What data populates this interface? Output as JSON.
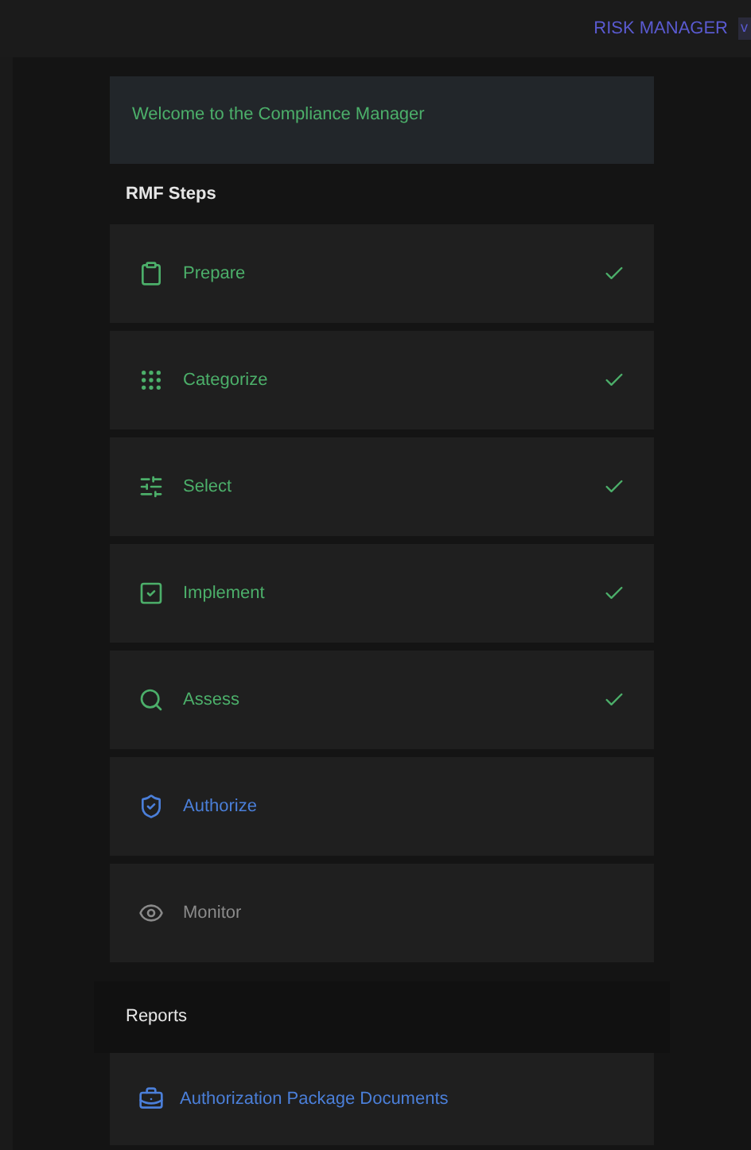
{
  "header": {
    "title": "RISK MANAGER",
    "version": "v"
  },
  "welcome": {
    "text": "Welcome to the Compliance Manager"
  },
  "rmf_steps": {
    "heading": "RMF Steps",
    "items": [
      {
        "label": "Prepare",
        "completed": true,
        "selected": false
      },
      {
        "label": "Categorize",
        "completed": true,
        "selected": false
      },
      {
        "label": "Select",
        "completed": true,
        "selected": false
      },
      {
        "label": "Implement",
        "completed": true,
        "selected": false
      },
      {
        "label": "Assess",
        "completed": true,
        "selected": false
      },
      {
        "label": "Authorize",
        "completed": false,
        "selected": true
      },
      {
        "label": "Monitor",
        "completed": false,
        "selected": false
      }
    ]
  },
  "reports": {
    "heading": "Reports",
    "items": [
      {
        "label": "Authorization Package Documents"
      }
    ]
  }
}
